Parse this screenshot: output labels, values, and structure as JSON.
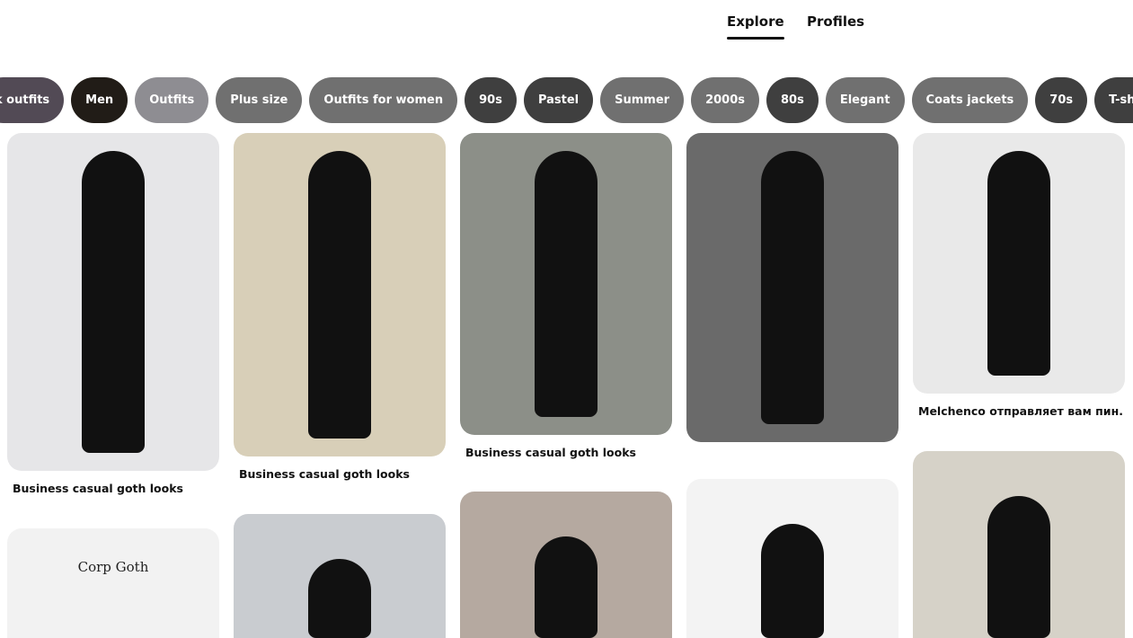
{
  "tabs": [
    {
      "label": "Explore",
      "active": true
    },
    {
      "label": "Profiles",
      "active": false
    }
  ],
  "chips": [
    {
      "label": "k outfits",
      "color": "#524a55"
    },
    {
      "label": "Men",
      "color": "#211c17"
    },
    {
      "label": "Outfits",
      "color": "#8e8d92"
    },
    {
      "label": "Plus size",
      "color": "#707070"
    },
    {
      "label": "Outfits for women",
      "color": "#707070"
    },
    {
      "label": "90s",
      "color": "#3f3f3f"
    },
    {
      "label": "Pastel",
      "color": "#3f3f3f"
    },
    {
      "label": "Summer",
      "color": "#707070"
    },
    {
      "label": "2000s",
      "color": "#707070"
    },
    {
      "label": "80s",
      "color": "#3f3f3f"
    },
    {
      "label": "Elegant",
      "color": "#707070"
    },
    {
      "label": "Coats jackets",
      "color": "#707070"
    },
    {
      "label": "70s",
      "color": "#3f3f3f"
    },
    {
      "label": "T-shirts tank tops",
      "color": "#3f3f3f"
    }
  ],
  "pins": [
    {
      "caption": "Business casual goth looks",
      "bg": "#e6e6e8"
    },
    {
      "caption": "Business casual goth looks",
      "bg": "#d8cfb8"
    },
    {
      "caption": "Business casual goth looks",
      "bg": "#8c8f88"
    },
    {
      "caption": "",
      "bg": "#6a6a6a"
    },
    {
      "caption": "Melchenco отправляет вам пин.",
      "bg": "#e9e9e9"
    },
    {
      "caption": "",
      "bg": "#f2f2f2",
      "image_text": "Corp Goth"
    },
    {
      "caption": "",
      "bg": "#c9ccd0"
    },
    {
      "caption": "",
      "bg": "#b5a9a0"
    },
    {
      "caption": "",
      "bg": "#f3f3f3"
    },
    {
      "caption": "",
      "bg": "#d6d2c8"
    }
  ]
}
